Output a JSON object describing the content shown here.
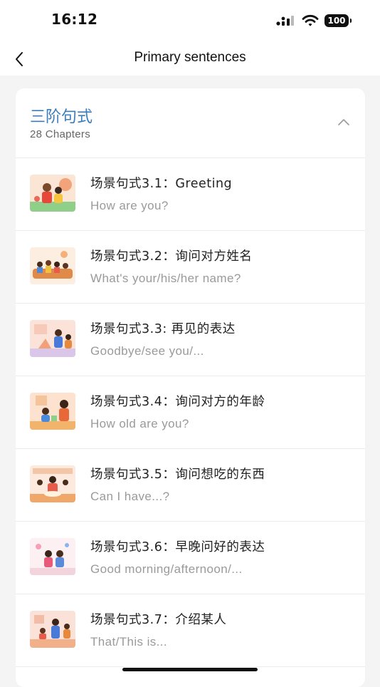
{
  "status_bar": {
    "time": "16:12",
    "battery": "100",
    "icons": [
      "cellular-signal-icon",
      "wifi-icon",
      "battery-icon"
    ]
  },
  "nav": {
    "title": "Primary sentences",
    "back_icon": "chevron-left-icon"
  },
  "section": {
    "title": "三阶句式",
    "subtitle": "28 Chapters",
    "toggle_icon": "chevron-up-icon",
    "title_color": "#3c7dc0"
  },
  "lessons": [
    {
      "title": "场景句式3.1：Greeting",
      "subtitle": "How are you?",
      "thumb_icon": "family-illustration-thumbnail"
    },
    {
      "title": "场景句式3.2：询问对方姓名",
      "subtitle": "What's your/his/her name?",
      "thumb_icon": "family-illustration-thumbnail"
    },
    {
      "title": "场景句式3.3: 再见的表达",
      "subtitle": "Goodbye/see you/...",
      "thumb_icon": "family-illustration-thumbnail"
    },
    {
      "title": "场景句式3.4：询问对方的年龄",
      "subtitle": "How old are you?",
      "thumb_icon": "family-illustration-thumbnail"
    },
    {
      "title": "场景句式3.5：询问想吃的东西",
      "subtitle": "Can I have...?",
      "thumb_icon": "family-illustration-thumbnail"
    },
    {
      "title": "场景句式3.6：早晚问好的表达",
      "subtitle": "Good morning/afternoon/...",
      "thumb_icon": "family-illustration-thumbnail"
    },
    {
      "title": "场景句式3.7：介绍某人",
      "subtitle": "That/This is...",
      "thumb_icon": "family-illustration-thumbnail"
    }
  ]
}
